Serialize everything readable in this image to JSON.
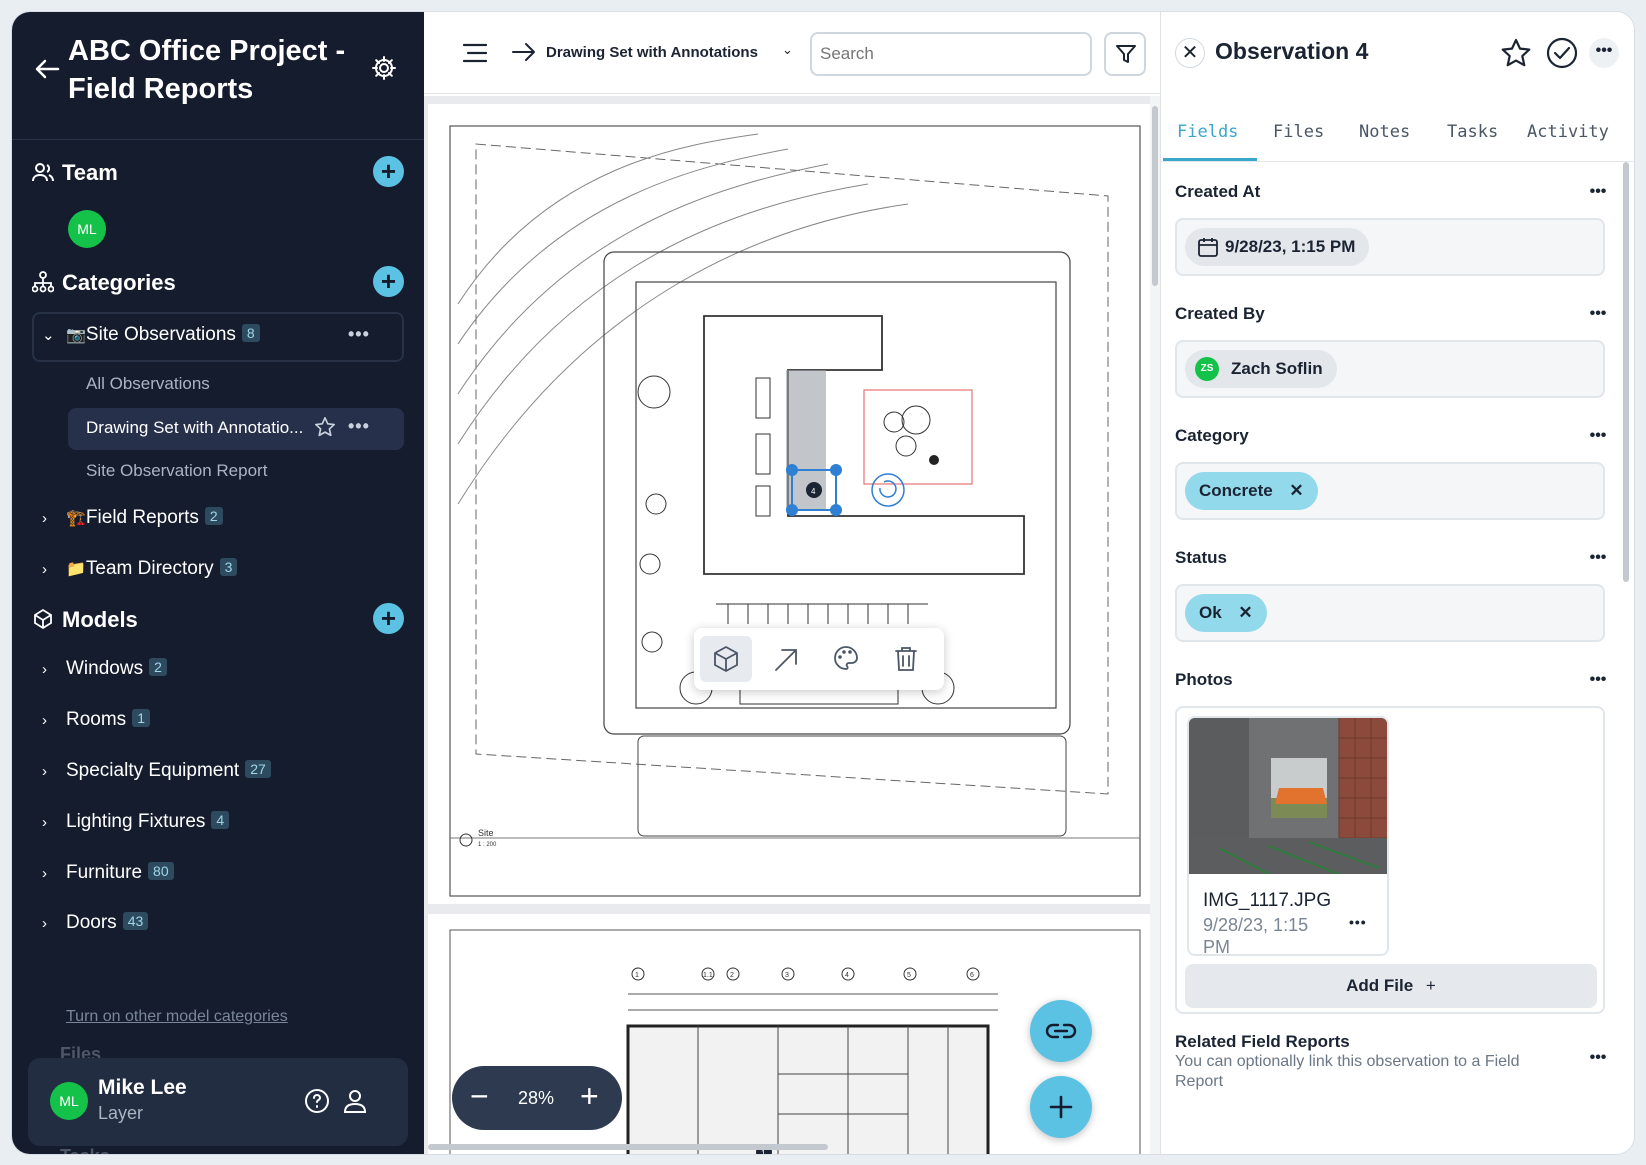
{
  "sidebar": {
    "project_title": "ABC Office Project - Field Reports",
    "team": {
      "label": "Team",
      "member_initials": "ML"
    },
    "categories": {
      "label": "Categories",
      "site_observations": {
        "emoji": "📷",
        "label": "Site Observations",
        "count": "8"
      },
      "sub_items": {
        "all": "All Observations",
        "drawing": "Drawing Set with Annotatio...",
        "report": "Site Observation Report"
      },
      "field_reports": {
        "emoji": "🏗️",
        "label": "Field Reports",
        "count": "2"
      },
      "team_directory": {
        "emoji": "📁",
        "label": "Team Directory",
        "count": "3"
      }
    },
    "models": {
      "label": "Models",
      "items": [
        {
          "label": "Windows",
          "count": "2"
        },
        {
          "label": "Rooms",
          "count": "1"
        },
        {
          "label": "Specialty Equipment",
          "count": "27"
        },
        {
          "label": "Lighting Fixtures",
          "count": "4"
        },
        {
          "label": "Furniture",
          "count": "80"
        },
        {
          "label": "Doors",
          "count": "43"
        }
      ],
      "toggle_link": "Turn on other model categories"
    },
    "ghost_files": "Files",
    "ghost_tasks": "Tasks",
    "user": {
      "initials": "ML",
      "name": "Mike Lee",
      "role": "Layer"
    }
  },
  "center": {
    "breadcrumb": "Drawing Set with Annotations",
    "search_placeholder": "Search",
    "zoom": {
      "minus": "−",
      "value": "28%",
      "plus": "+"
    },
    "drawing": {
      "site_label": "Site",
      "scale": "1 : 200",
      "pin_4": "4",
      "pin_1": "1",
      "grid_labels": [
        "1",
        "1.1",
        "2",
        "3",
        "3",
        "4",
        "4.1",
        "5",
        "6"
      ]
    }
  },
  "panel": {
    "title": "Observation 4",
    "tabs": [
      "Fields",
      "Files",
      "Notes",
      "Tasks",
      "Activity"
    ],
    "fields": {
      "created_at": {
        "label": "Created At",
        "value": "9/28/23, 1:15 PM"
      },
      "created_by": {
        "label": "Created By",
        "initials": "ZS",
        "value": "Zach Soflin"
      },
      "category": {
        "label": "Category",
        "value": "Concrete"
      },
      "status": {
        "label": "Status",
        "value": "Ok"
      },
      "photos": {
        "label": "Photos",
        "file_name": "IMG_1117.JPG",
        "file_date": "9/28/23, 1:15 PM",
        "add_file": "Add File"
      },
      "related": {
        "label": "Related Field Reports",
        "description": "You can optionally link this observation to a Field Report"
      }
    }
  },
  "colors": {
    "sidebar_bg": "#141c2d",
    "accent": "#5cc2e3",
    "tab_active": "#3aa7c9",
    "chip_blue": "#93d9ec",
    "avatar_green": "#14c24a"
  }
}
